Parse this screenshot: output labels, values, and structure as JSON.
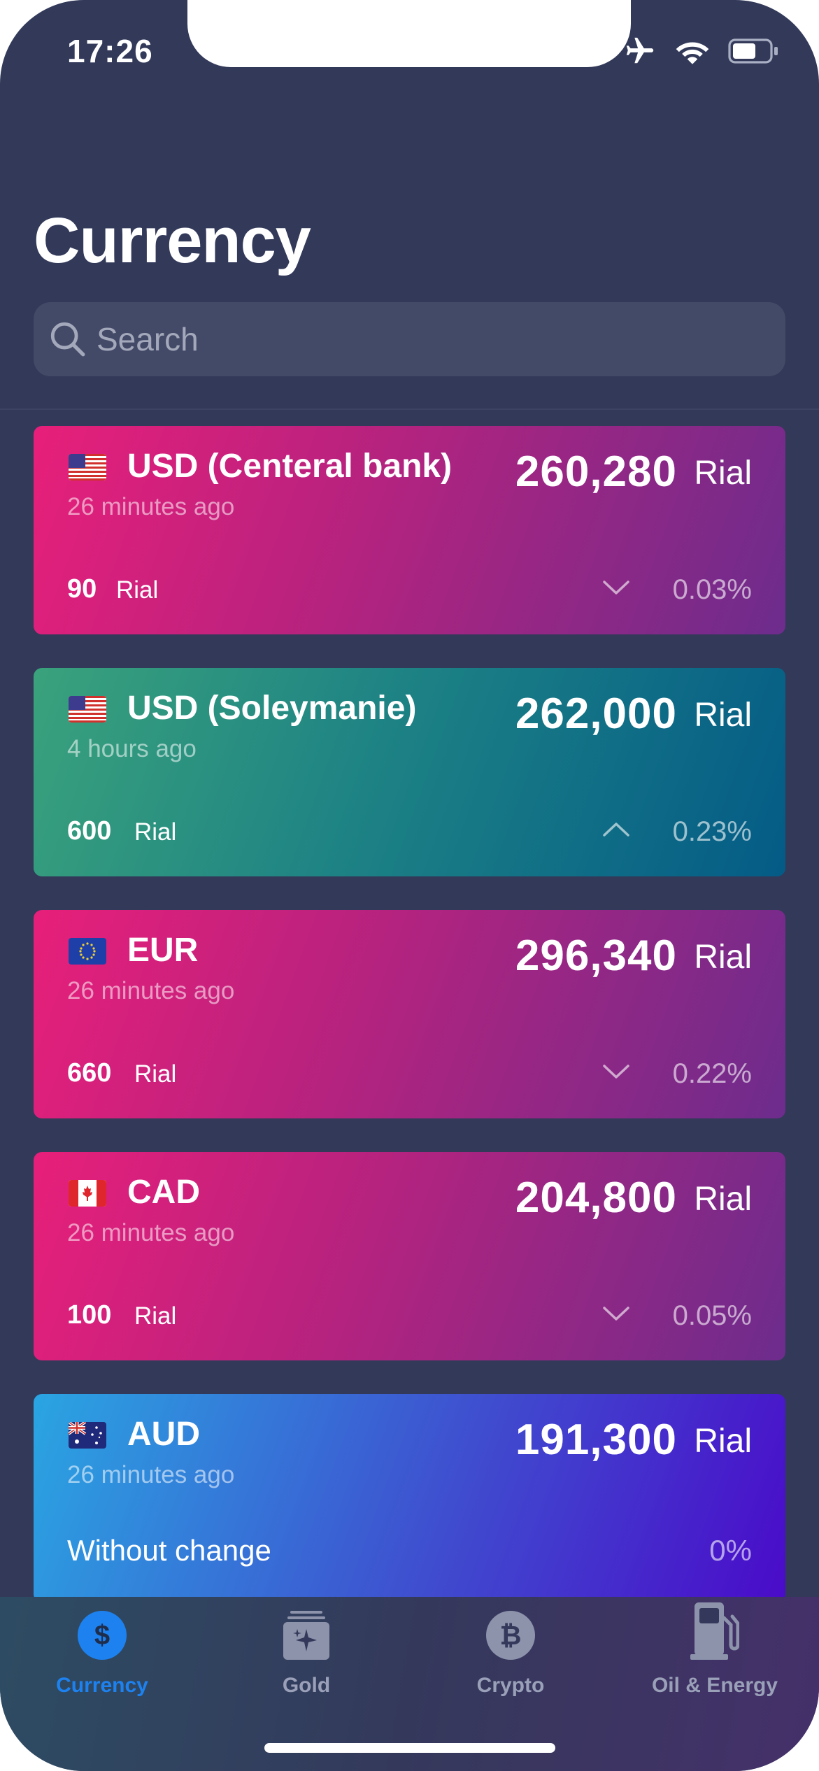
{
  "status_bar": {
    "time": "17:26"
  },
  "page": {
    "title": "Currency"
  },
  "search": {
    "placeholder": "Search"
  },
  "cards": [
    {
      "name": "USD (Centeral bank)",
      "updated": "26 minutes ago",
      "price": "260,280",
      "unit": "Rial",
      "change": "90",
      "change_unit": "Rial",
      "direction": "down",
      "percent": "0.03%"
    },
    {
      "name": "USD (Soleymanie)",
      "updated": "4 hours ago",
      "price": "262,000",
      "unit": "Rial",
      "change": "600",
      "change_unit": "Rial",
      "direction": "up",
      "percent": "0.23%"
    },
    {
      "name": "EUR",
      "updated": "26 minutes ago",
      "price": "296,340",
      "unit": "Rial",
      "change": "660",
      "change_unit": "Rial",
      "direction": "down",
      "percent": "0.22%"
    },
    {
      "name": "CAD",
      "updated": "26 minutes ago",
      "price": "204,800",
      "unit": "Rial",
      "change": "100",
      "change_unit": "Rial",
      "direction": "down",
      "percent": "0.05%"
    },
    {
      "name": "AUD",
      "updated": "26 minutes ago",
      "price": "191,300",
      "unit": "Rial",
      "no_change_label": "Without change",
      "direction": "flat",
      "percent": "0%"
    }
  ],
  "tabs": [
    {
      "label": "Currency",
      "icon": "dollar-icon",
      "active": true
    },
    {
      "label": "Gold",
      "icon": "gold-icon",
      "active": false
    },
    {
      "label": "Crypto",
      "icon": "bitcoin-icon",
      "active": false
    },
    {
      "label": "Oil & Energy",
      "icon": "fuel-pump-icon",
      "active": false
    }
  ],
  "colors": {
    "background": "#323959",
    "accent": "#1d82f0",
    "card_down": "#e71f7a",
    "card_up": "#3aa27c",
    "card_flat": "#3f4ecf"
  }
}
